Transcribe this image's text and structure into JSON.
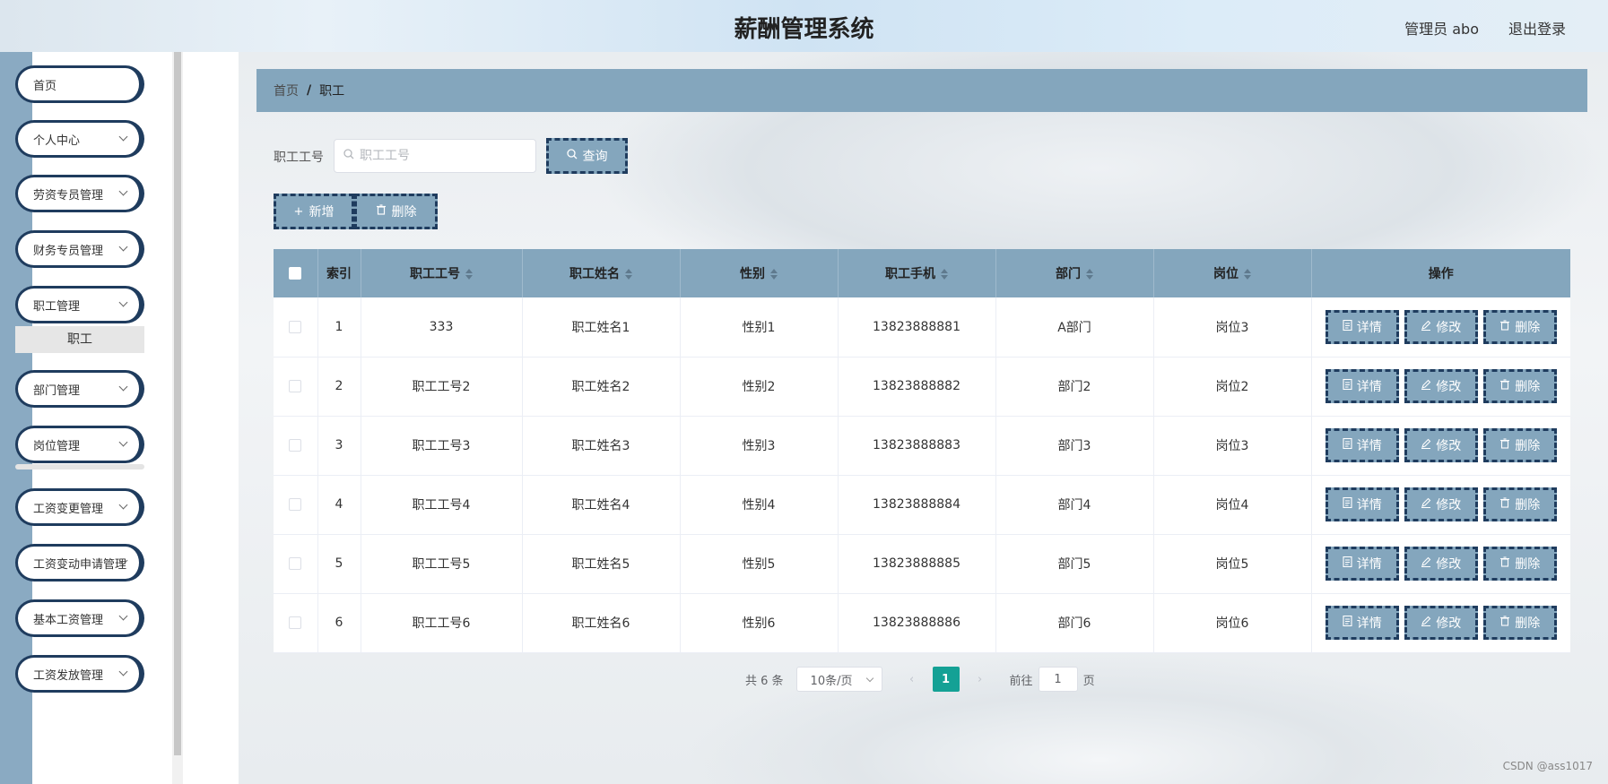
{
  "header": {
    "title": "薪酬管理系统",
    "user": "管理员 abo",
    "logout": "退出登录"
  },
  "sidebar": {
    "items": [
      {
        "label": "首页",
        "has_arrow": false
      },
      {
        "label": "个人中心",
        "has_arrow": true
      },
      {
        "label": "劳资专员管理",
        "has_arrow": true
      },
      {
        "label": "财务专员管理",
        "has_arrow": true
      },
      {
        "label": "职工管理",
        "has_arrow": true
      },
      {
        "label": "部门管理",
        "has_arrow": true
      },
      {
        "label": "岗位管理",
        "has_arrow": true
      },
      {
        "label": "工资变更管理",
        "has_arrow": true
      },
      {
        "label": "工资变动申请管理",
        "has_arrow": true
      },
      {
        "label": "基本工资管理",
        "has_arrow": true
      },
      {
        "label": "工资发放管理",
        "has_arrow": true
      }
    ],
    "submenu": "职工"
  },
  "breadcrumb": {
    "home": "首页",
    "separator": "/",
    "current": "职工"
  },
  "search": {
    "label": "职工工号",
    "placeholder": "职工工号",
    "button": "查询"
  },
  "actions": {
    "add": "新增",
    "delete": "删除"
  },
  "table": {
    "headers": [
      "索引",
      "职工工号",
      "职工姓名",
      "性别",
      "职工手机",
      "部门",
      "岗位",
      "操作"
    ],
    "rows": [
      [
        "1",
        "333",
        "职工姓名1",
        "性别1",
        "13823888881",
        "A部门",
        "岗位3"
      ],
      [
        "2",
        "职工工号2",
        "职工姓名2",
        "性别2",
        "13823888882",
        "部门2",
        "岗位2"
      ],
      [
        "3",
        "职工工号3",
        "职工姓名3",
        "性别3",
        "13823888883",
        "部门3",
        "岗位3"
      ],
      [
        "4",
        "职工工号4",
        "职工姓名4",
        "性别4",
        "13823888884",
        "部门4",
        "岗位4"
      ],
      [
        "5",
        "职工工号5",
        "职工姓名5",
        "性别5",
        "13823888885",
        "部门5",
        "岗位5"
      ],
      [
        "6",
        "职工工号6",
        "职工姓名6",
        "性别6",
        "13823888886",
        "部门6",
        "岗位6"
      ]
    ],
    "row_actions": {
      "detail": "详情",
      "edit": "修改",
      "delete": "删除"
    }
  },
  "pagination": {
    "total": "共 6 条",
    "page_size": "10条/页",
    "current_page": "1",
    "goto_label": "前往",
    "goto_value": "1",
    "page_suffix": "页"
  },
  "watermark": "CSDN @ass1017",
  "icons": {
    "search": "search-icon",
    "plus": "plus-icon",
    "trash": "trash-icon",
    "document": "document-icon",
    "edit": "edit-icon"
  },
  "colors": {
    "accent": "#84a6bd",
    "border": "#1f3c5e",
    "active_page": "#14a195"
  }
}
